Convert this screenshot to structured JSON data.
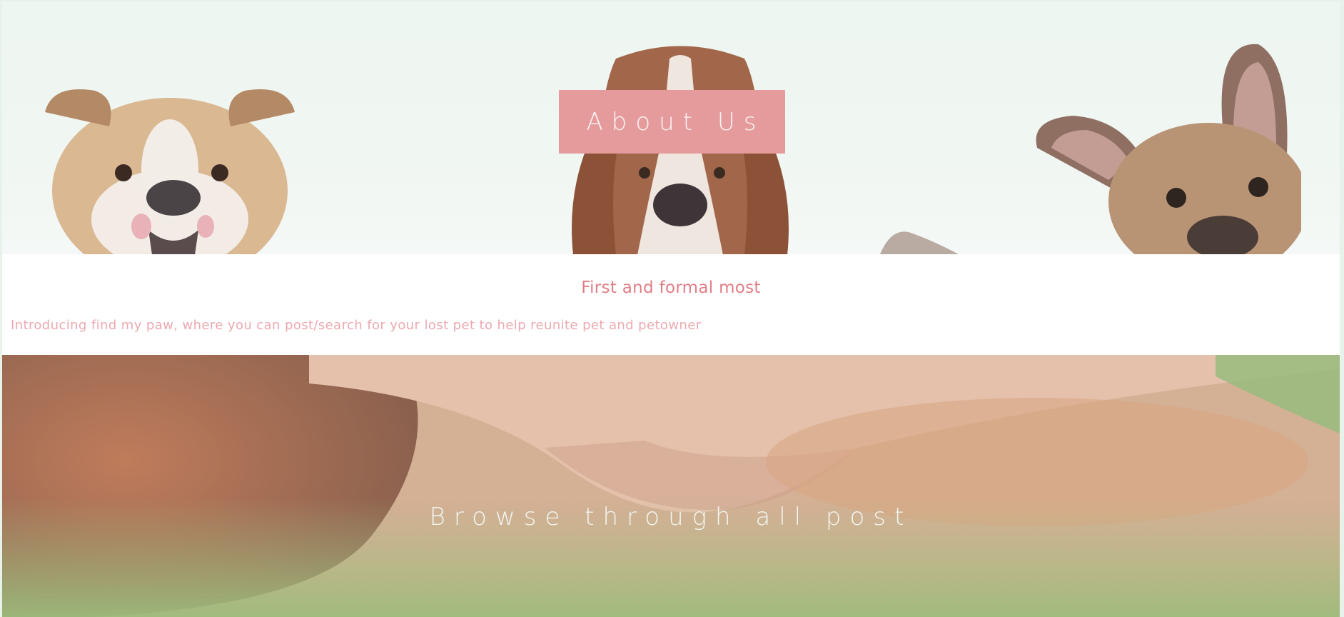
{
  "hero": {
    "about_label": "About Us",
    "badge_color": "#e59b9c"
  },
  "intro": {
    "heading": "First and formal most",
    "text": "Introducing find my paw, where you can post/search for your lost pet to help reunite pet and petowner",
    "heading_color": "#e07e85",
    "text_color": "#eba9b0"
  },
  "browse": {
    "title": "Browse through all post"
  }
}
